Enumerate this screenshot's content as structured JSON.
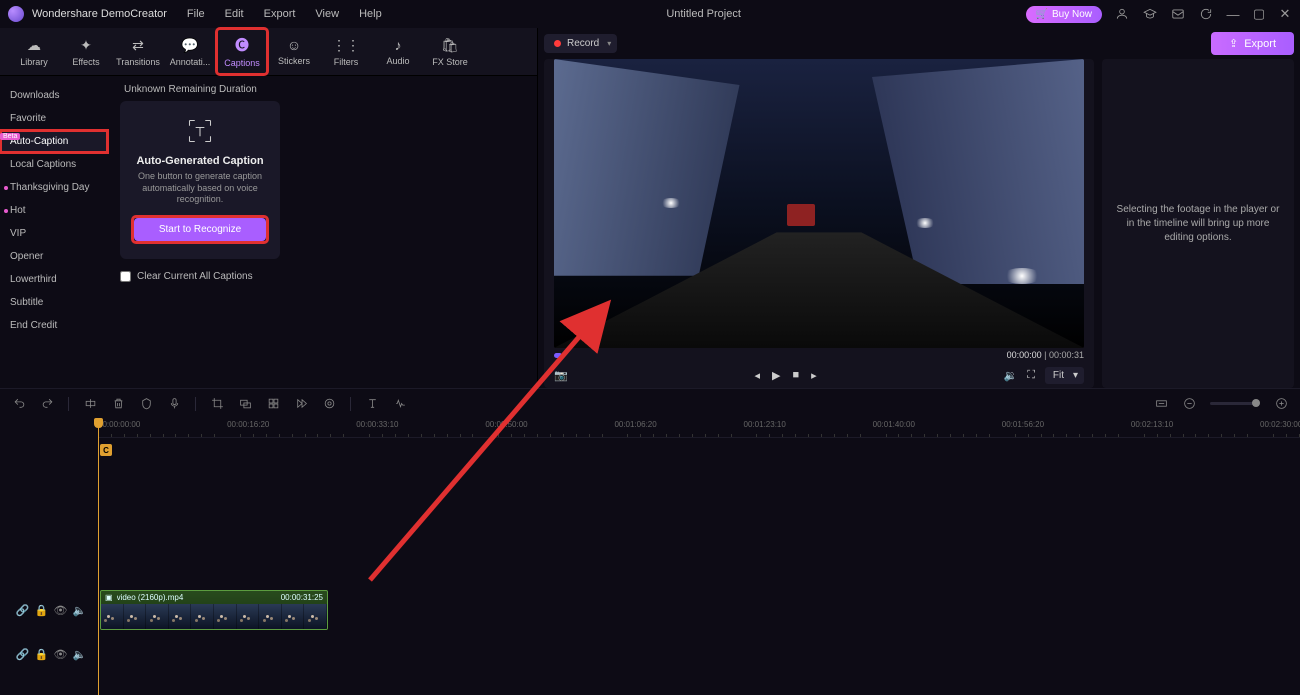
{
  "app_name": "Wondershare DemoCreator",
  "menu": {
    "file": "File",
    "edit": "Edit",
    "export": "Export",
    "view": "View",
    "help": "Help"
  },
  "project_title": "Untitled Project",
  "buy_now": "Buy Now",
  "export_btn": "Export",
  "tool_tabs": {
    "library": "Library",
    "effects": "Effects",
    "transitions": "Transitions",
    "annotations": "Annotati...",
    "captions": "Captions",
    "stickers": "Stickers",
    "filters": "Filters",
    "audio": "Audio",
    "fxstore": "FX Store"
  },
  "duration_label": "Unknown Remaining Duration",
  "categories": {
    "downloads": "Downloads",
    "favorite": "Favorite",
    "auto_caption": "Auto-Caption",
    "auto_caption_badge": "Beta",
    "local_captions": "Local Captions",
    "thanksgiving": "Thanksgiving Day",
    "hot": "Hot",
    "vip": "VIP",
    "opener": "Opener",
    "lowerthird": "Lowerthird",
    "subtitle": "Subtitle",
    "end_credit": "End Credit"
  },
  "caption_card": {
    "title": "Auto-Generated Caption",
    "desc": "One button to generate caption automatically based on voice recognition.",
    "button": "Start to Recognize",
    "clear": "Clear Current All Captions"
  },
  "record_btn": "Record",
  "player": {
    "time_current": "00:00:00",
    "time_total": "00:00:31",
    "fit": "Fit"
  },
  "inspector_text": "Selecting the footage in the player or in the timeline will bring up more editing options.",
  "ruler": [
    "00:00:00:00",
    "00:00:16:20",
    "00:00:33:10",
    "00:00:50:00",
    "00:01:06:20",
    "00:01:23:10",
    "00:01:40:00",
    "00:01:56:20",
    "00:02:13:10",
    "00:02:30:00"
  ],
  "clip": {
    "name": "video (2160p).mp4",
    "end": "00:00:31:25"
  },
  "clip_marker": "C"
}
